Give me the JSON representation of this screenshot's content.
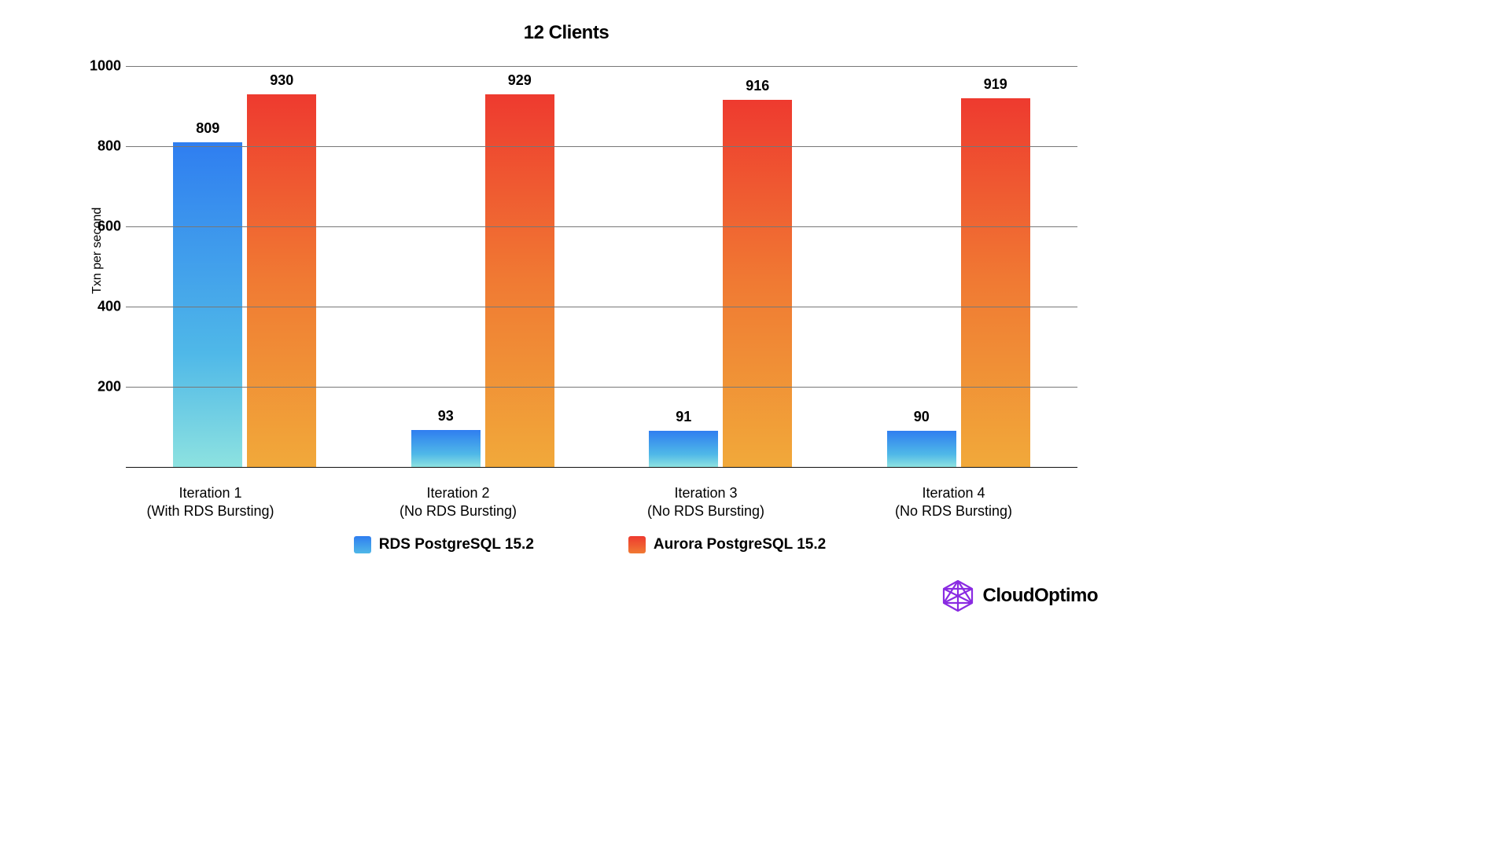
{
  "chart_data": {
    "type": "bar",
    "title": "12 Clients",
    "ylabel": "Txn per second",
    "xlabel": "",
    "ylim": [
      0,
      1000
    ],
    "yticks": [
      0,
      200,
      400,
      600,
      800,
      1000
    ],
    "categories": [
      {
        "line1": "Iteration 1",
        "line2": "(With RDS Bursting)"
      },
      {
        "line1": "Iteration 2",
        "line2": "(No RDS Bursting)"
      },
      {
        "line1": "Iteration 3",
        "line2": "(No RDS Bursting)"
      },
      {
        "line1": "Iteration 4",
        "line2": "(No RDS Bursting)"
      }
    ],
    "series": [
      {
        "name": "RDS PostgreSQL 15.2",
        "key": "rds",
        "values": [
          809,
          93,
          91,
          90
        ]
      },
      {
        "name": "Aurora PostgreSQL 15.2",
        "key": "aurora",
        "values": [
          930,
          929,
          916,
          919
        ]
      }
    ]
  },
  "brand": {
    "name": "CloudOptimo",
    "color": "#8a2be2"
  }
}
